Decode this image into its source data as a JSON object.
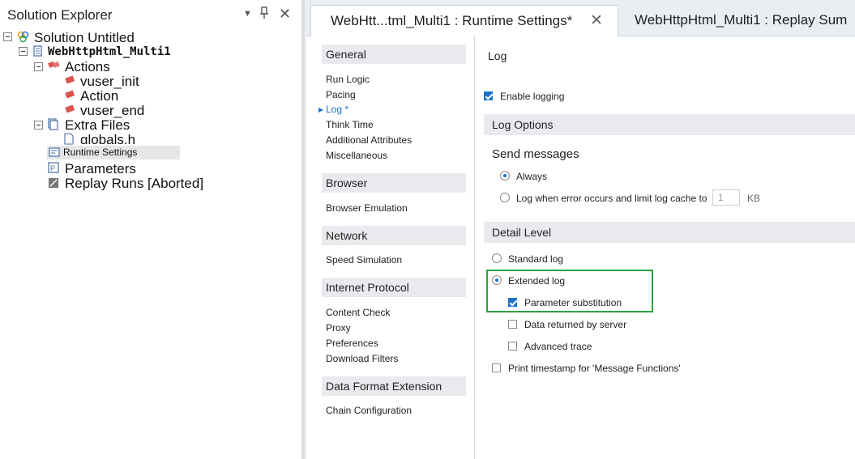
{
  "solution_explorer": {
    "title": "Solution Explorer",
    "pin_icon": "pin-icon",
    "close_icon": "close-icon",
    "tree": {
      "solution": "Solution Untitled",
      "script": "WebHttpHtml_Multi1",
      "actions": "Actions",
      "vuser_init": "vuser_init",
      "action": "Action",
      "vuser_end": "vuser_end",
      "extra_files": "Extra Files",
      "globals": "globals.h",
      "runtime_settings": "Runtime Settings",
      "parameters": "Parameters",
      "replay_runs": "Replay Runs [Aborted]"
    }
  },
  "tabs": {
    "active": "WebHtt...tml_Multi1 : Runtime Settings*",
    "inactive": "WebHttpHtml_Multi1 : Replay Sum"
  },
  "nav": {
    "general": "General",
    "general_items": [
      "Run Logic",
      "Pacing",
      "Log *",
      "Think Time",
      "Additional Attributes",
      "Miscellaneous"
    ],
    "browser": "Browser",
    "browser_items": [
      "Browser Emulation"
    ],
    "network": "Network",
    "network_items": [
      "Speed Simulation"
    ],
    "internet_protocol": "Internet Protocol",
    "internet_protocol_items": [
      "Content Check",
      "Proxy",
      "Preferences",
      "Download Filters"
    ],
    "data_format": "Data Format Extension",
    "data_format_items": [
      "Chain Configuration"
    ]
  },
  "content": {
    "page_title": "Log",
    "enable_logging": "Enable logging",
    "log_options": "Log Options",
    "send_messages": "Send messages",
    "always": "Always",
    "log_when_error": "Log when error occurs and limit log cache to",
    "cache_value": "1",
    "cache_unit": "KB",
    "detail_level": "Detail Level",
    "standard_log": "Standard log",
    "extended_log": "Extended log",
    "parameter_substitution": "Parameter substitution",
    "data_returned": "Data returned by server",
    "advanced_trace": "Advanced trace",
    "print_timestamp": "Print timestamp for 'Message Functions'"
  },
  "colors": {
    "accent": "#1e73c8",
    "highlight_border": "#2ea043",
    "section_bg": "#e8eaed"
  }
}
